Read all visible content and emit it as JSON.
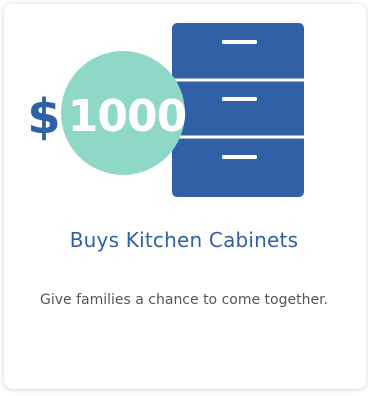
{
  "card": {
    "amount_symbol": "$",
    "amount_value": "1000",
    "title": "Buys Kitchen Cabinets",
    "description": "Give families a  chance to come together."
  },
  "icons": {
    "cabinet": "cabinet-drawers-icon",
    "amount_circle": "amount-circle-badge"
  },
  "colors": {
    "cabinet_blue": "#3160a7",
    "circle_teal": "#8fd8c7",
    "title_blue": "#2e61a6",
    "text_gray": "#555555",
    "dollar_blue": "#2e61a6"
  }
}
